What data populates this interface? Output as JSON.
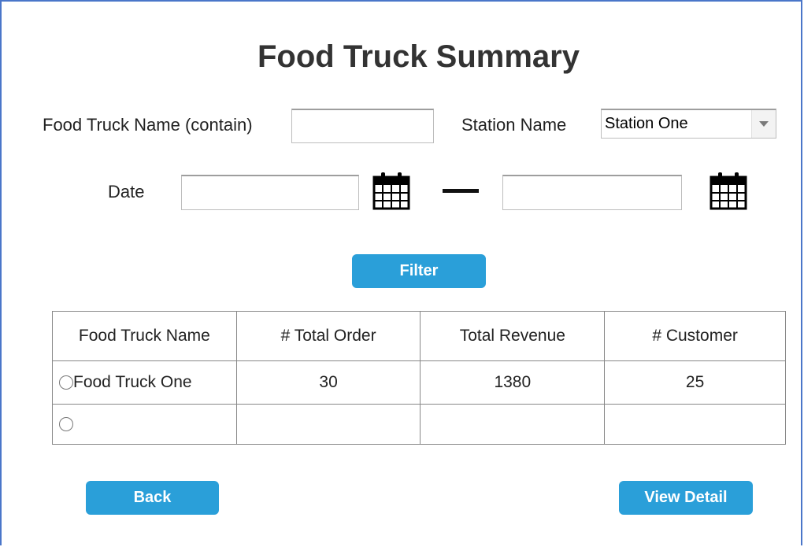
{
  "title": "Food Truck Summary",
  "filters": {
    "truck_name_label": "Food Truck Name (contain)",
    "truck_name_value": "",
    "station_label": "Station Name",
    "station_selected": "Station One",
    "date_label": "Date",
    "date_from": "",
    "date_to": "",
    "filter_button": "Filter"
  },
  "table": {
    "headers": [
      "Food Truck Name",
      "# Total Order",
      "Total Revenue",
      "# Customer"
    ],
    "rows": [
      [
        "Food Truck One",
        "30",
        "1380",
        "25"
      ],
      [
        "",
        "",
        "",
        ""
      ]
    ]
  },
  "footer": {
    "back_button": "Back",
    "view_detail_button": "View Detail"
  },
  "icons": {
    "calendar": "calendar-icon",
    "dropdown": "chevron-down-icon"
  },
  "colors": {
    "accent": "#2a9fd9",
    "frame": "#4a76c9"
  }
}
